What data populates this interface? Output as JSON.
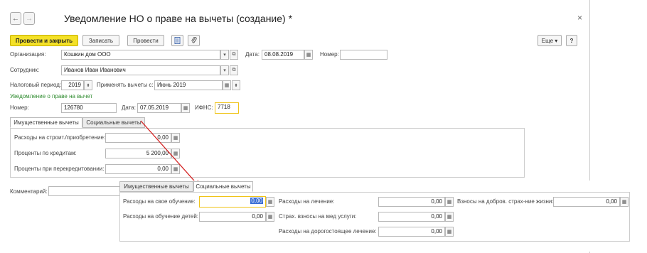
{
  "window": {
    "back": "←",
    "forward": "→",
    "title": "Уведомление НО о праве на вычеты (создание) *",
    "close": "×"
  },
  "toolbar": {
    "post_close": "Провести и закрыть",
    "save": "Записать",
    "post": "Провести",
    "more": "Еще",
    "more_arrow": "▾",
    "help": "?"
  },
  "form": {
    "org_label": "Организация:",
    "org_value": "Кошкин дом ООО",
    "date_label": "Дата:",
    "date_value": "08.08.2019",
    "number_label": "Номер:",
    "number_value": "",
    "employee_label": "Сотрудник:",
    "employee_value": "Иванов Иван Иванович",
    "period_label": "Налоговый период:",
    "period_value": "2019",
    "apply_label": "Применять вычеты с:",
    "apply_value": "Июнь 2019",
    "notice_section": "Уведомление о праве на вычет",
    "notice_number_label": "Номер:",
    "notice_number_value": "126780",
    "notice_date_label": "Дата:",
    "notice_date_value": "07.05.2019",
    "ifns_label": "ИФНС:",
    "ifns_value": "7718",
    "comment_label": "Комментарий:"
  },
  "tabs": {
    "property": "Имущественные вычеты",
    "social": "Социальные вычеты"
  },
  "property_deductions": {
    "build_label": "Расходы на строит./приобретение:",
    "build_value": "0,00",
    "loan_label": "Проценты по кредитам:",
    "loan_value": "5 200,00",
    "refin_label": "Проценты при перекредитовании:",
    "refin_value": "0,00"
  },
  "social_deductions": {
    "own_edu_label": "Расходы на свое обучение:",
    "own_edu_value": "0,00",
    "child_edu_label": "Расходы на обучение детей:",
    "child_edu_value": "0,00",
    "treatment_label": "Расходы на лечение:",
    "treatment_value": "0,00",
    "med_ins_label": "Страх. взносы на мед услуги:",
    "med_ins_value": "0,00",
    "expensive_label": "Расходы на дорогостоящее лечение:",
    "expensive_value": "0,00",
    "life_ins_label": "Взносы на добров. страх-ние жизни:",
    "life_ins_value": "0,00"
  },
  "colors": {
    "primary": "#f4e128",
    "arrow": "#d32020",
    "accent_green": "#2e8b2e",
    "focus": "#f0c419"
  },
  "icons": [
    "arrow-left-icon",
    "arrow-right-icon",
    "close-icon",
    "report-icon",
    "paperclip-icon",
    "calendar-icon",
    "dropdown-icon",
    "open-icon",
    "spin-icon"
  ]
}
